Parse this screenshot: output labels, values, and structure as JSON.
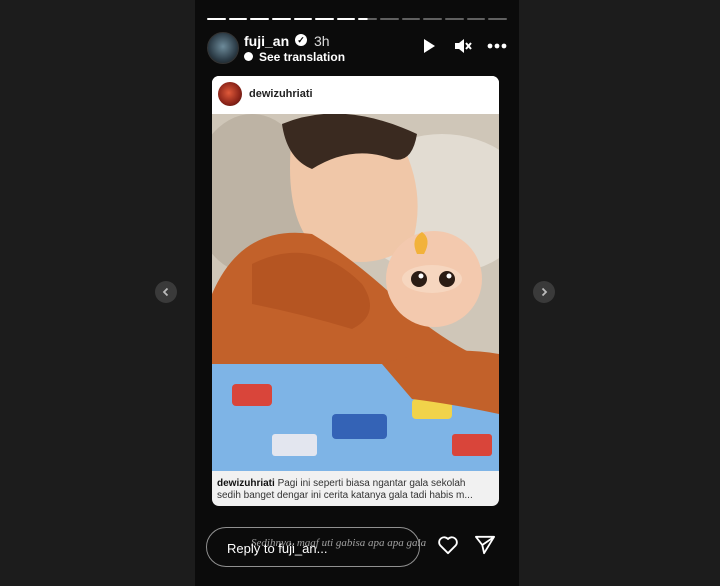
{
  "story": {
    "progress_total": 14,
    "progress_done": 7,
    "progress_active_index": 7,
    "username": "fuji_an",
    "verified_mark": "✓",
    "time_ago": "3h",
    "translation_label": "See translation",
    "icons": [
      "play-icon",
      "mute-icon",
      "more-icon"
    ]
  },
  "shared_post": {
    "username": "dewizuhriati",
    "caption_user": "dewizuhriati",
    "caption_line1": "Pagi ini seperti biasa ngantar gala sekolah",
    "caption_line2": "sedih banget dengar ini cerita katanya gala tadi habis m..."
  },
  "reply": {
    "placeholder": "Reply to fuji_an...",
    "overlay_text": "Sedihnya, maaf uti gabisa apa apa gala"
  },
  "nav": {
    "prev_icon": "chevron-left-icon",
    "next_icon": "chevron-right-icon"
  }
}
